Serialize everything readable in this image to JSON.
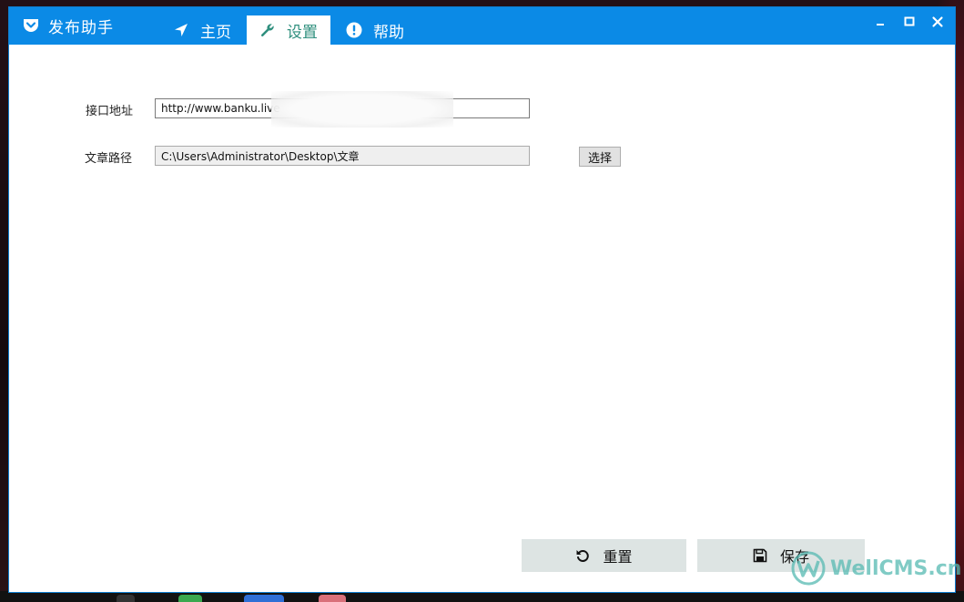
{
  "window": {
    "title": "发布助手",
    "tabs": [
      {
        "label": "主页",
        "icon": "navigation-arrow-icon",
        "active": false
      },
      {
        "label": "设置",
        "icon": "wrench-icon",
        "active": true
      },
      {
        "label": "帮助",
        "icon": "exclamation-circle-icon",
        "active": false
      }
    ]
  },
  "settings": {
    "api_label": "接口地址",
    "api_value": "http://www.banku.live",
    "path_label": "文章路径",
    "path_value": "C:\\Users\\Administrator\\Desktop\\文章",
    "choose_label": "选择"
  },
  "actions": {
    "reset_label": "重置",
    "save_label": "保存"
  },
  "watermark": {
    "text": "WellCMS.cn"
  },
  "colors": {
    "titlebar": "#0b8ae6",
    "active_tab_text": "#2f8f7e",
    "button_bg": "#dde4e3"
  }
}
